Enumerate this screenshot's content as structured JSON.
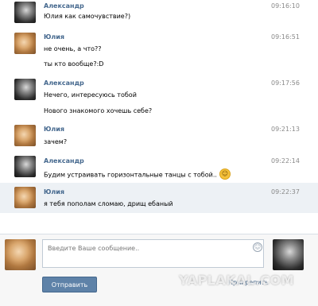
{
  "messages": [
    {
      "author": "Александр",
      "avatar": "alexander",
      "time": "09:16:10",
      "lines": [
        "Юлия как самочувствие?)"
      ],
      "highlight": false
    },
    {
      "author": "Юлия",
      "avatar": "yulia",
      "time": "09:16:51",
      "lines": [
        "не очень, а что??",
        "ты кто вообще?:D"
      ],
      "highlight": false
    },
    {
      "author": "Александр",
      "avatar": "alexander",
      "time": "09:17:56",
      "lines": [
        "Нечего, интересуюсь тобой",
        "Нового знакомого хочешь себе?"
      ],
      "highlight": false
    },
    {
      "author": "Юлия",
      "avatar": "yulia",
      "time": "09:21:13",
      "lines": [
        "зачем?"
      ],
      "highlight": false
    },
    {
      "author": "Александр",
      "avatar": "alexander",
      "time": "09:22:14",
      "lines": [
        "Будим устраивать горизонтальные танцы с тобой.."
      ],
      "highlight": false,
      "emoji": "smiley-icon"
    },
    {
      "author": "Юлия",
      "avatar": "yulia",
      "time": "09:22:37",
      "lines": [
        "я тебя пополам сломаю, дрищ ебаный"
      ],
      "highlight": true
    }
  ],
  "composer": {
    "placeholder": "Введите Ваше сообщение..",
    "send_label": "Отправить",
    "attach_label": "Прикрепить"
  },
  "watermark": "YAPLAKAL.COM",
  "colors": {
    "name": "#45688e",
    "button": "#5e82a8",
    "highlight": "#edf1f5"
  }
}
